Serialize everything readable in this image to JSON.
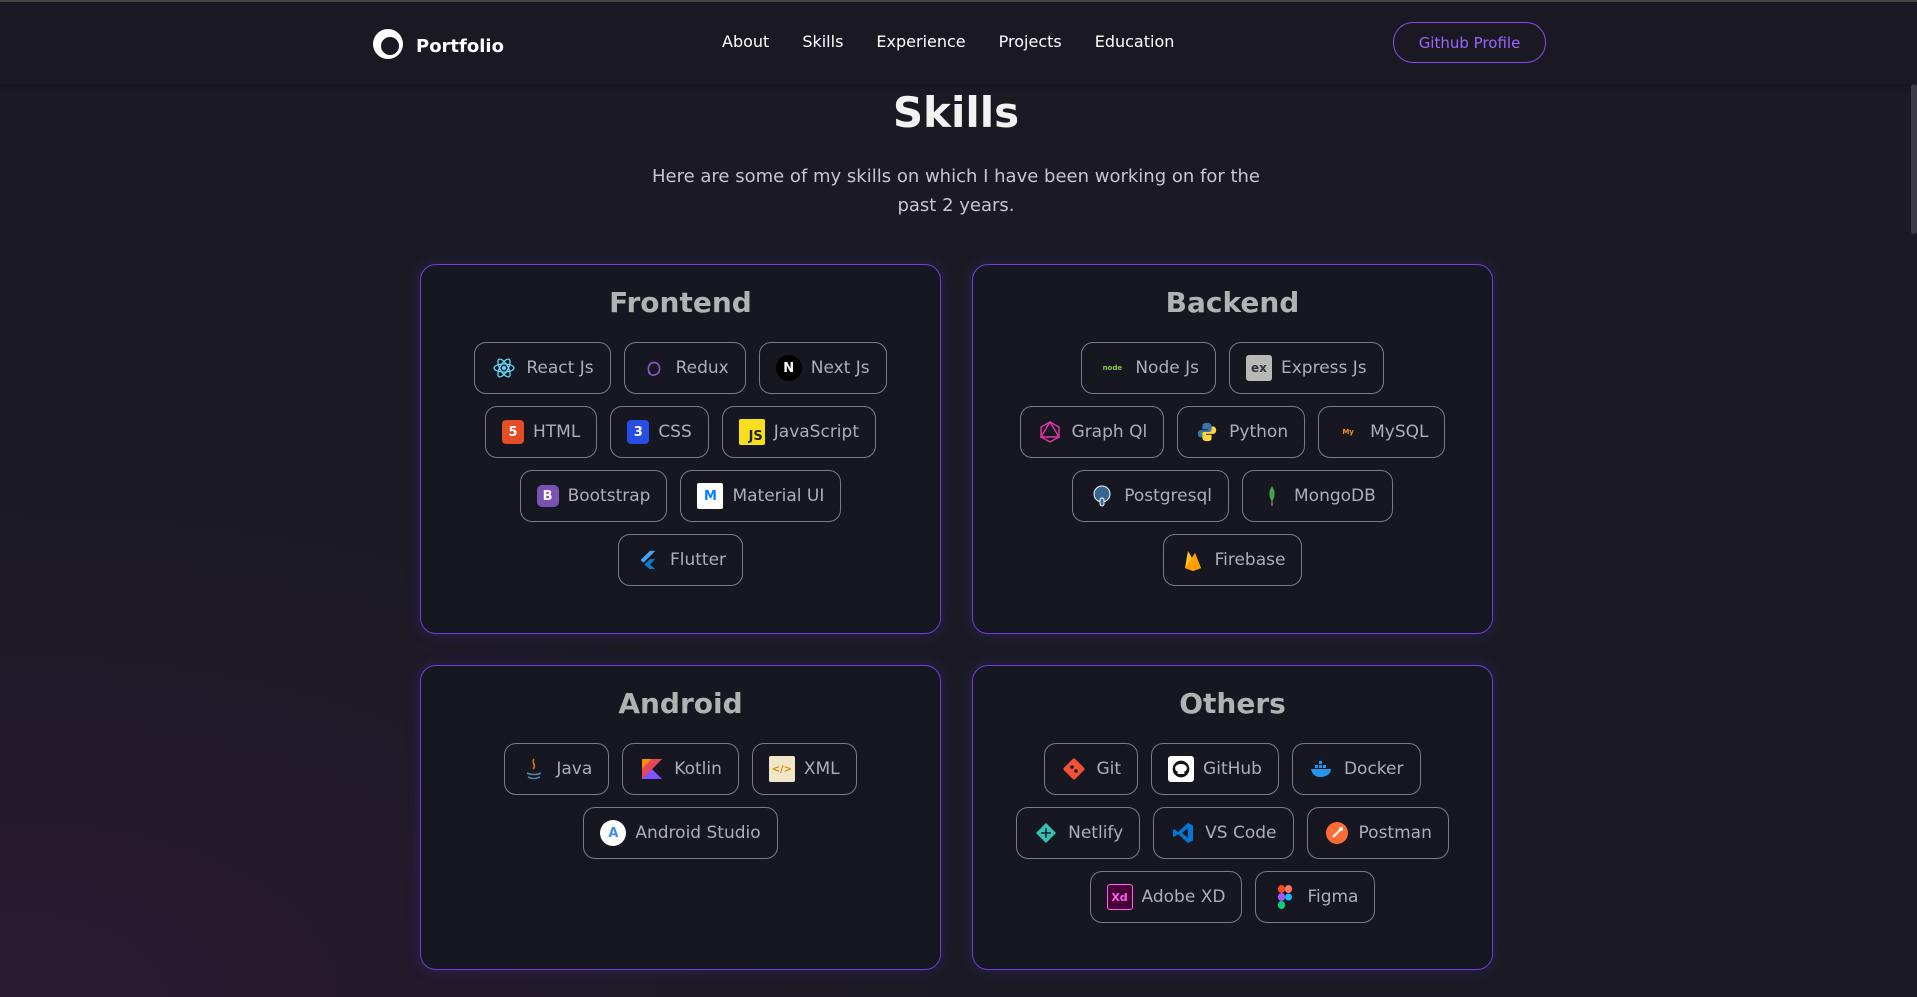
{
  "brand": {
    "name": "Portfolio"
  },
  "nav": {
    "links": [
      "About",
      "Skills",
      "Experience",
      "Projects",
      "Education"
    ],
    "github_label": "Github Profile"
  },
  "hero": {
    "title": "Skills",
    "subtitle_line1": "Here are some of my skills on which I have been working on for the",
    "subtitle_line2": "past 2 years."
  },
  "colors": {
    "accent": "#854ce6",
    "background": "#1b1a24",
    "card_border": "#6a3fd6"
  },
  "sections": [
    {
      "title": "Frontend",
      "skills": [
        {
          "name": "React Js",
          "icon": "react-icon"
        },
        {
          "name": "Redux",
          "icon": "redux-icon"
        },
        {
          "name": "Next Js",
          "icon": "nextjs-icon"
        },
        {
          "name": "HTML",
          "icon": "html-icon"
        },
        {
          "name": "CSS",
          "icon": "css-icon"
        },
        {
          "name": "JavaScript",
          "icon": "javascript-icon"
        },
        {
          "name": "Bootstrap",
          "icon": "bootstrap-icon"
        },
        {
          "name": "Material UI",
          "icon": "material-ui-icon"
        },
        {
          "name": "Flutter",
          "icon": "flutter-icon"
        }
      ]
    },
    {
      "title": "Backend",
      "skills": [
        {
          "name": "Node Js",
          "icon": "nodejs-icon"
        },
        {
          "name": "Express Js",
          "icon": "express-icon"
        },
        {
          "name": "Graph Ql",
          "icon": "graphql-icon"
        },
        {
          "name": "Python",
          "icon": "python-icon"
        },
        {
          "name": "MySQL",
          "icon": "mysql-icon"
        },
        {
          "name": "Postgresql",
          "icon": "postgresql-icon"
        },
        {
          "name": "MongoDB",
          "icon": "mongodb-icon"
        },
        {
          "name": "Firebase",
          "icon": "firebase-icon"
        }
      ]
    },
    {
      "title": "Android",
      "skills": [
        {
          "name": "Java",
          "icon": "java-icon"
        },
        {
          "name": "Kotlin",
          "icon": "kotlin-icon"
        },
        {
          "name": "XML",
          "icon": "xml-icon"
        },
        {
          "name": "Android Studio",
          "icon": "android-studio-icon"
        }
      ]
    },
    {
      "title": "Others",
      "skills": [
        {
          "name": "Git",
          "icon": "git-icon"
        },
        {
          "name": "GitHub",
          "icon": "github-icon"
        },
        {
          "name": "Docker",
          "icon": "docker-icon"
        },
        {
          "name": "Netlify",
          "icon": "netlify-icon"
        },
        {
          "name": "VS Code",
          "icon": "vscode-icon"
        },
        {
          "name": "Postman",
          "icon": "postman-icon"
        },
        {
          "name": "Adobe XD",
          "icon": "adobe-xd-icon"
        },
        {
          "name": "Figma",
          "icon": "figma-icon"
        }
      ]
    }
  ]
}
